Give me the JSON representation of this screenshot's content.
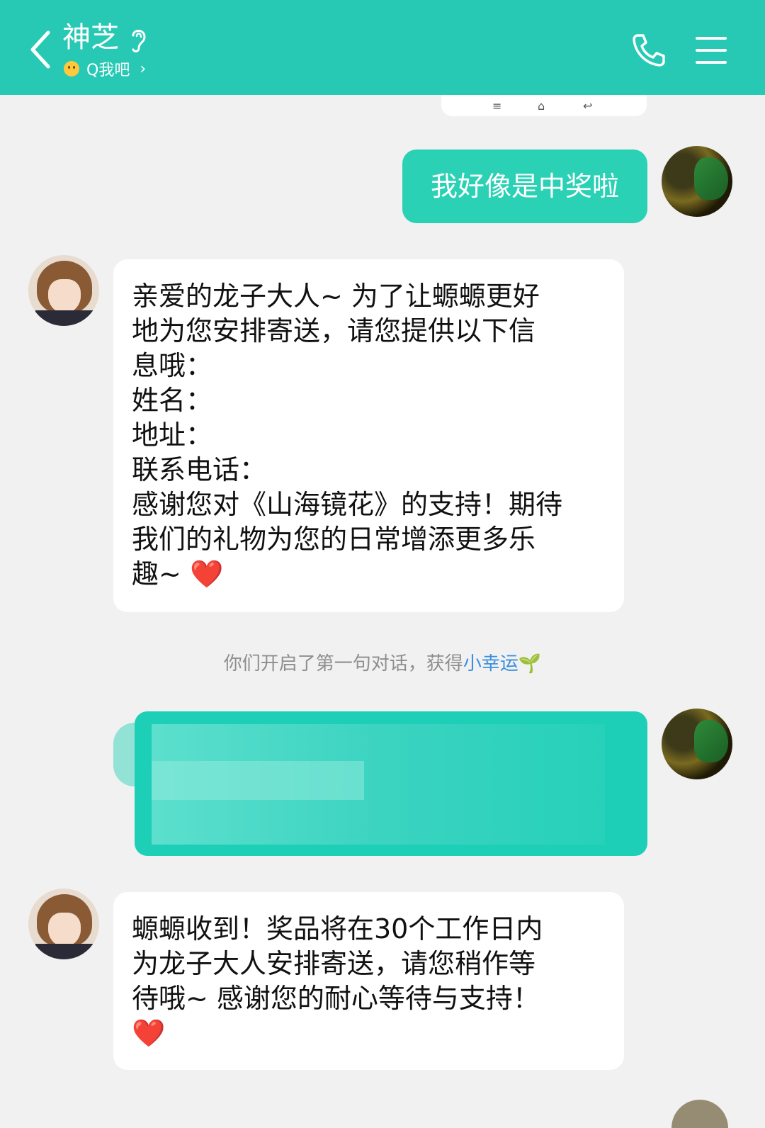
{
  "header": {
    "contact_name": "神芝",
    "status_text": "Q我吧",
    "colors": {
      "bar": "#27c9b4",
      "text": "#ffffff"
    },
    "icons": [
      "back-icon",
      "ear-icon",
      "smiley-icon",
      "chevron-right-icon",
      "phone-icon",
      "menu-icon"
    ]
  },
  "messages": [
    {
      "from": "me",
      "text": "我好像是中奖啦"
    },
    {
      "from": "bot",
      "text": "亲爱的龙子大人~ 为了让螈螈更好\n地为您安排寄送，请您提供以下信\n息哦：\n姓名：\n地址：\n联系电话：\n感谢您对《山海镜花》的支持！期待\n我们的礼物为您的日常增添更多乐\n趣~",
      "emoji": "❤️"
    },
    {
      "from": "me",
      "text": "",
      "redacted": true
    },
    {
      "from": "bot",
      "text": "螈螈收到！奖品将在30个工作日内\n为龙子大人安排寄送，请您稍作等\n待哦~ 感谢您的耐心等待与支持！",
      "emoji": "❤️"
    }
  ],
  "system_notice": {
    "prefix": "你们开启了第一句对话，获得",
    "link": "小幸运",
    "icon": "sprout-icon"
  },
  "colors": {
    "outgoing_bubble": "#2ad1b4",
    "incoming_bubble": "#ffffff",
    "background": "#f1f1f1",
    "link": "#3b8fe0"
  }
}
